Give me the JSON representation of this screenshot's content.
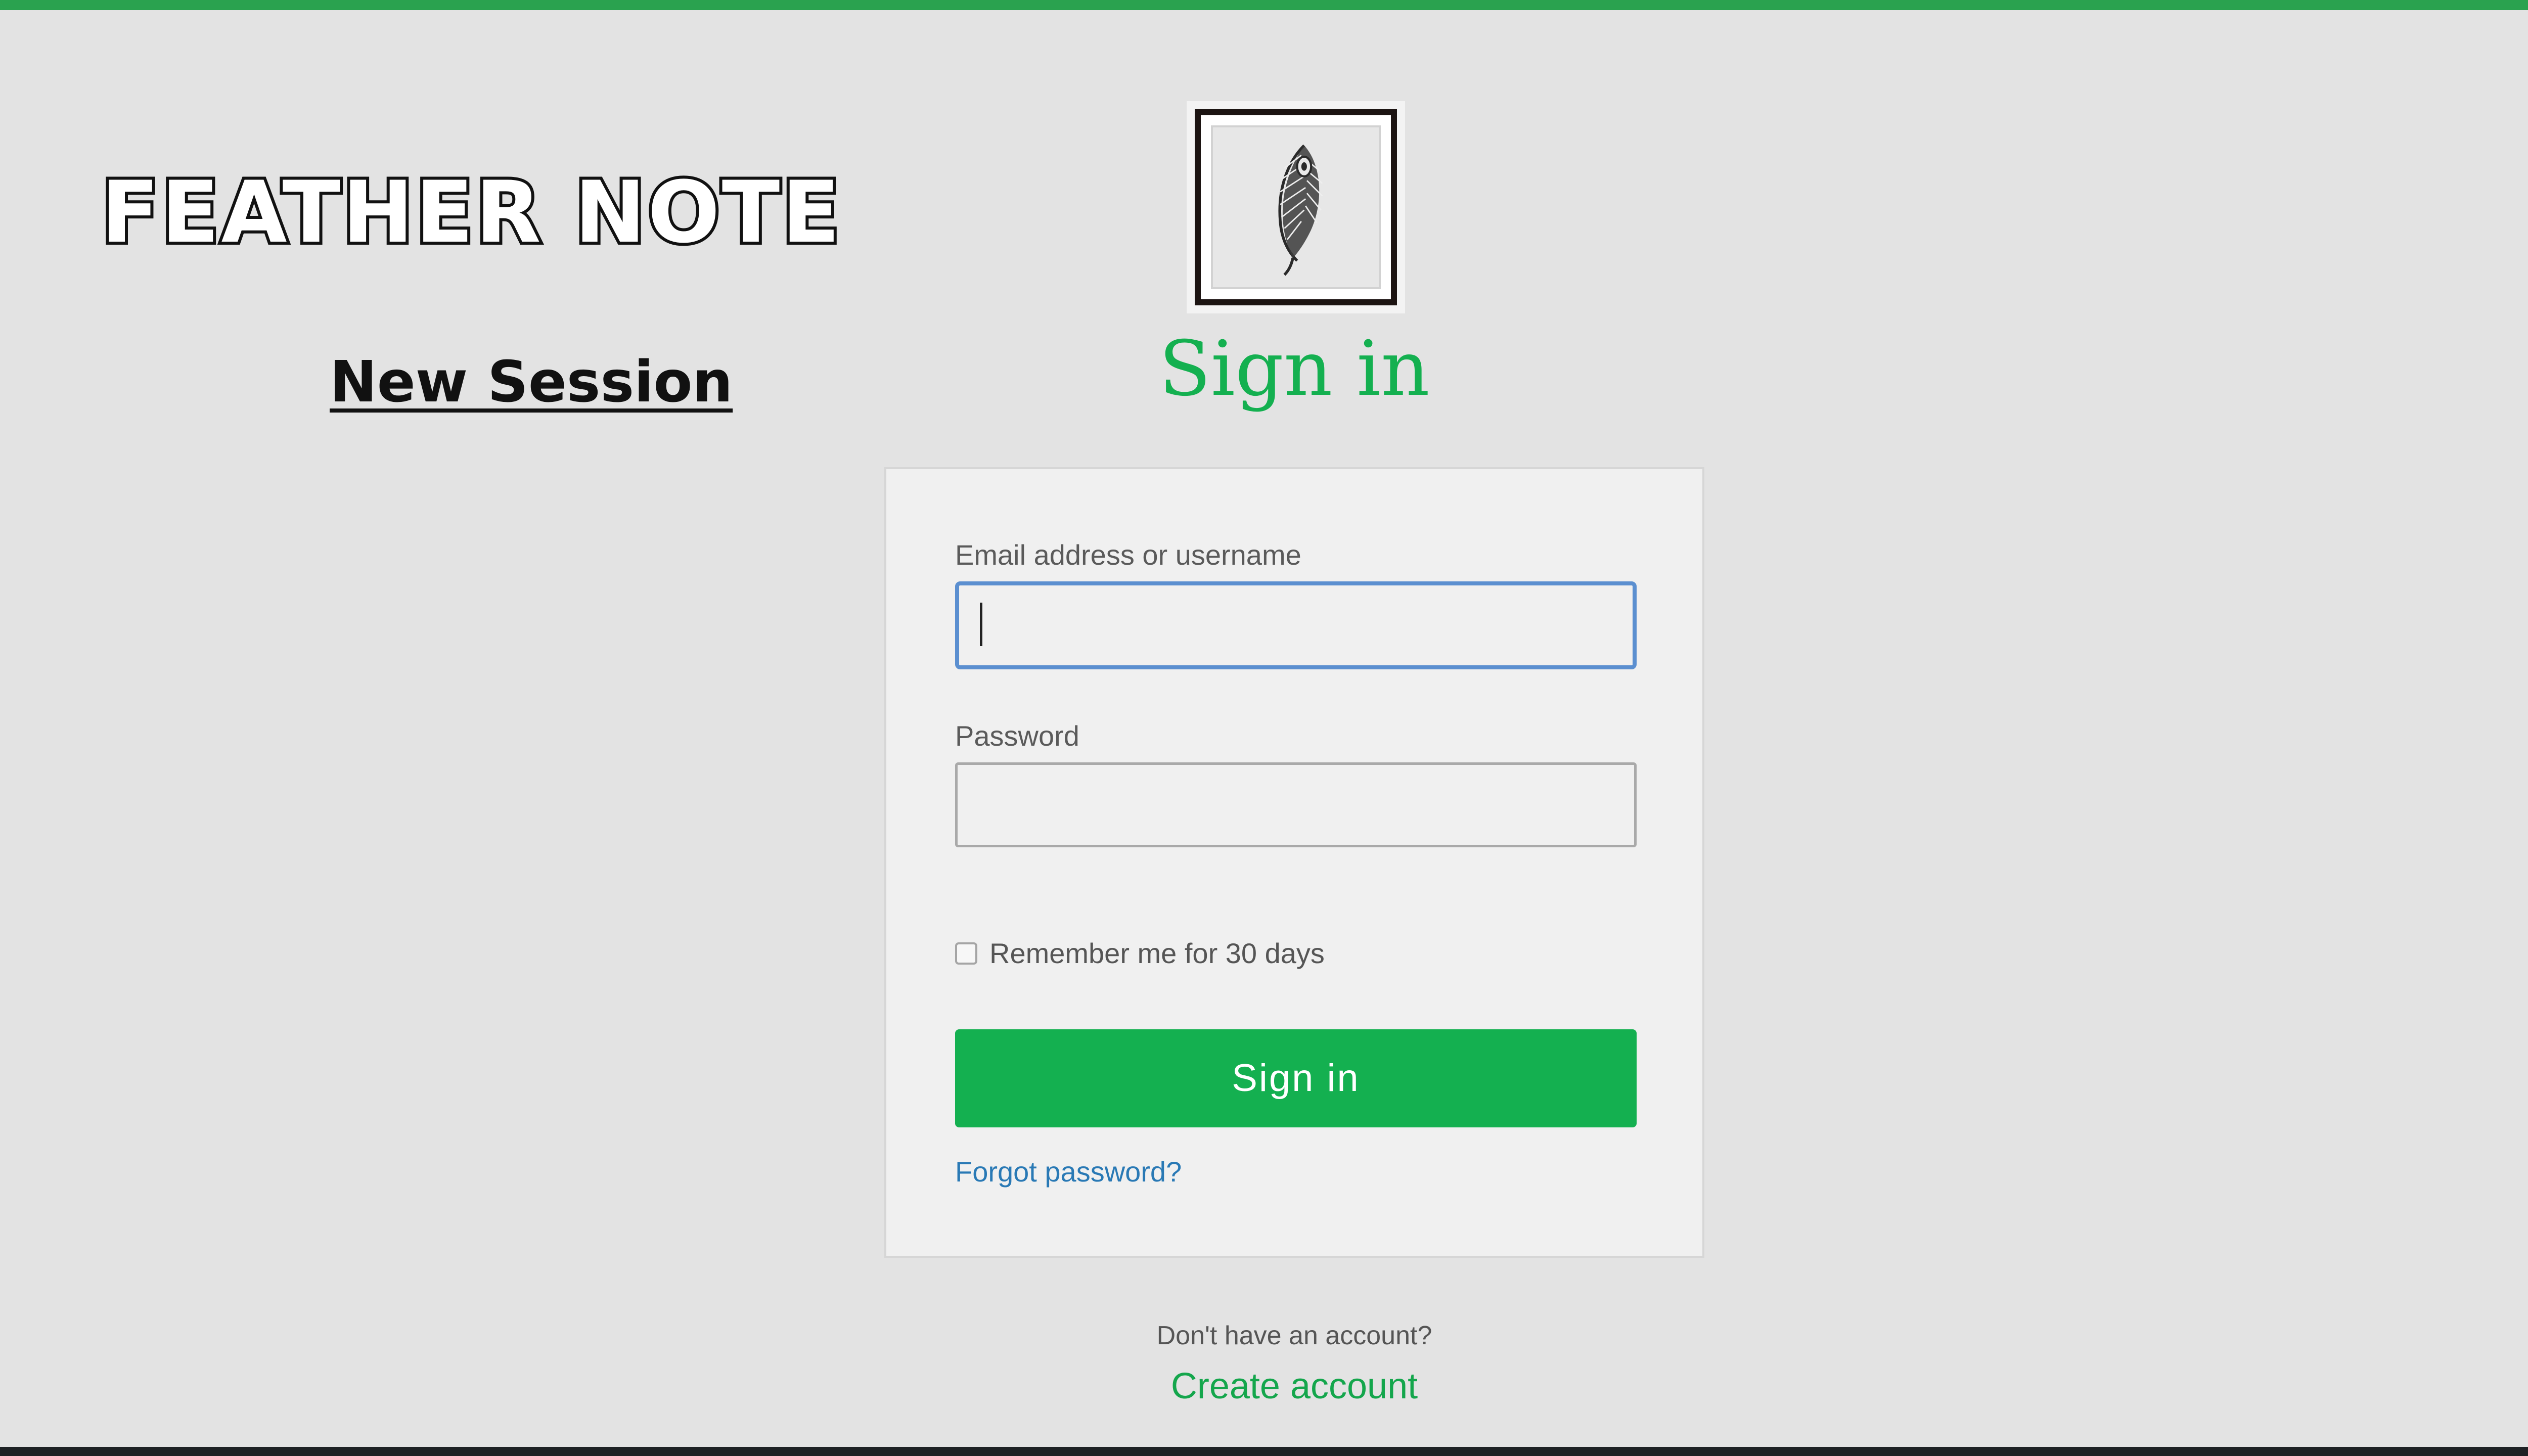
{
  "branding": {
    "app_name": "FEATHER NOTE",
    "logo_icon": "feather-icon",
    "accent_color": "#14b050"
  },
  "nav": {
    "session_link": "New Session"
  },
  "signin": {
    "title": "Sign in",
    "email_label": "Email address or username",
    "email_value": "",
    "password_label": "Password",
    "password_value": "",
    "remember_label": "Remember me for 30 days",
    "remember_checked": false,
    "submit_label": "Sign in",
    "forgot_link": "Forgot password?"
  },
  "footer": {
    "prompt": "Don't have an account?",
    "create_link": "Create account"
  }
}
